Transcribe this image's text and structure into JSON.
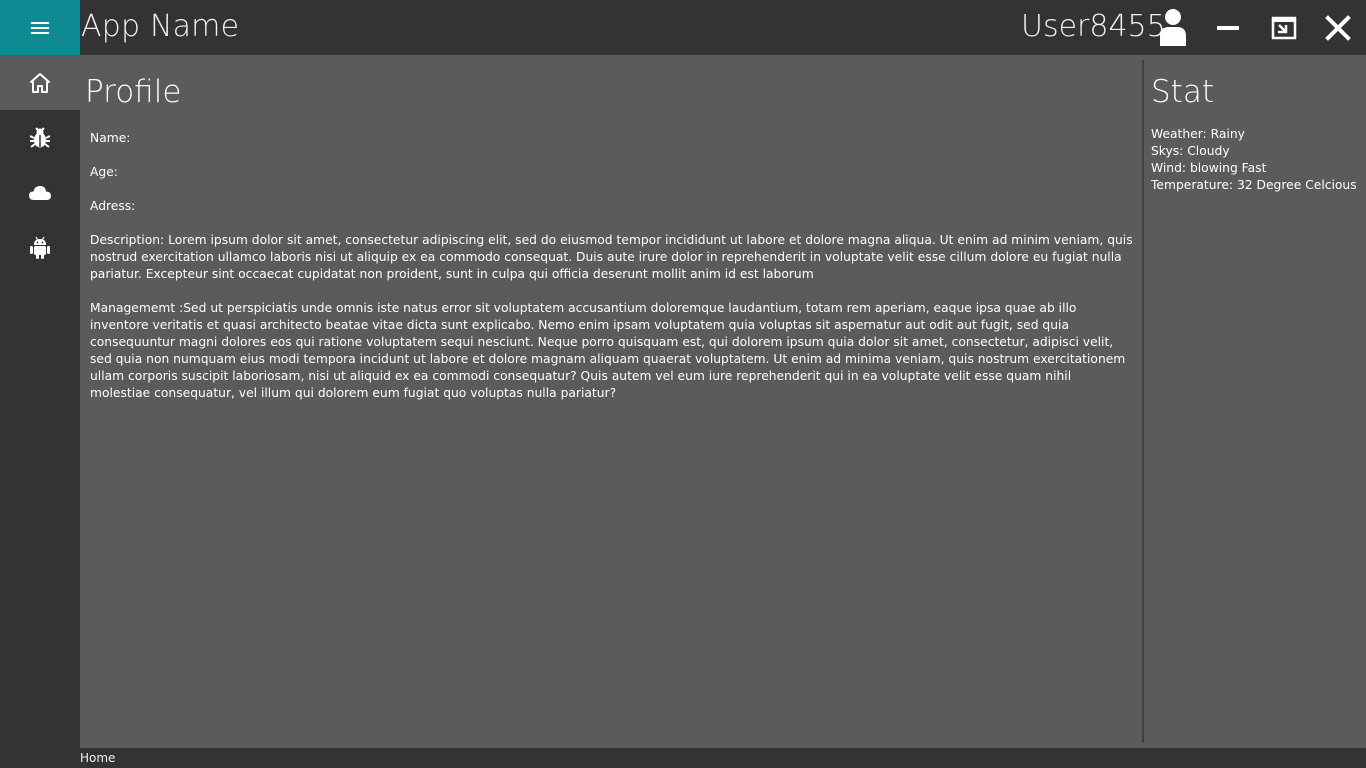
{
  "header": {
    "app_name": "App Name",
    "username": "User8455",
    "menu_icon": "hamburger-menu-icon",
    "user_icon": "user-person-icon",
    "window_controls": [
      "minimize-icon",
      "restore-window-icon",
      "close-icon"
    ],
    "accent_color": "#0e8b92"
  },
  "sidebar": {
    "items": [
      {
        "icon": "home-icon",
        "active": true
      },
      {
        "icon": "bug-icon",
        "active": false
      },
      {
        "icon": "cloud-icon",
        "active": false
      },
      {
        "icon": "android-icon",
        "active": false
      }
    ]
  },
  "profile": {
    "title": "Profile",
    "name_label": "Name:",
    "age_label": "Age:",
    "address_label": "Adress:",
    "description": "Description: Lorem ipsum dolor sit amet, consectetur adipiscing elit, sed do eiusmod tempor incididunt ut labore et dolore magna aliqua. Ut enim ad minim veniam, quis nostrud exercitation ullamco laboris nisi ut aliquip ex ea commodo consequat. Duis aute irure dolor in reprehenderit in voluptate velit esse cillum dolore eu fugiat nulla pariatur. Excepteur sint occaecat cupidatat non proident, sunt in culpa qui officia deserunt mollit anim id est laborum",
    "management": "Managememt :Sed ut perspiciatis unde omnis iste natus error sit voluptatem accusantium doloremque laudantium, totam rem aperiam, eaque ipsa quae ab illo inventore veritatis et quasi architecto beatae vitae dicta sunt explicabo. Nemo enim ipsam voluptatem quia voluptas sit aspernatur aut odit aut fugit, sed quia consequuntur magni dolores eos qui ratione voluptatem sequi nesciunt. Neque porro quisquam est, qui dolorem ipsum quia dolor sit amet, consectetur, adipisci velit, sed quia non numquam eius modi tempora incidunt ut labore et dolore magnam aliquam quaerat voluptatem. Ut enim ad minima veniam, quis nostrum exercitationem ullam corporis suscipit laboriosam, nisi ut aliquid ex ea commodi consequatur? Quis autem vel eum iure reprehenderit qui in ea voluptate velit esse quam nihil molestiae consequatur, vel illum qui dolorem eum fugiat quo voluptas nulla pariatur?"
  },
  "stat": {
    "title": "Stat",
    "lines": [
      "Weather: Rainy",
      "Skys: Cloudy",
      "Wind: blowing Fast",
      "Temperature: 32 Degree Celcious"
    ]
  },
  "status_bar": {
    "text": "Home"
  }
}
